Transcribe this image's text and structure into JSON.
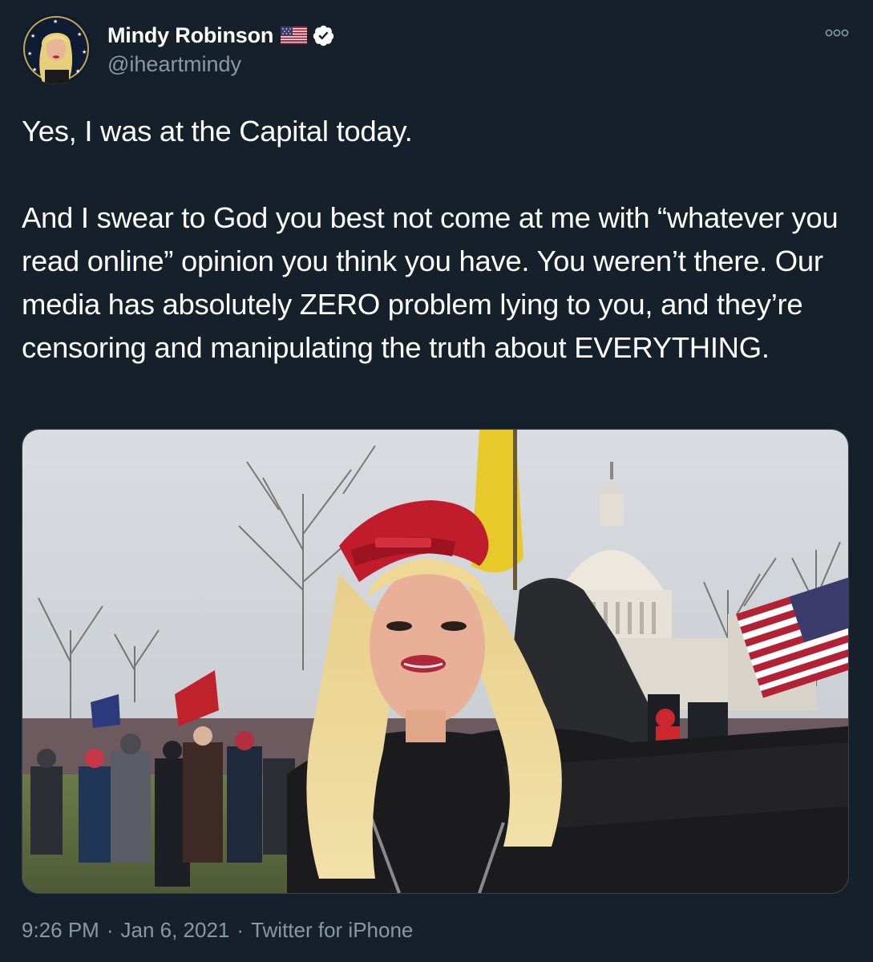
{
  "author": {
    "name": "Mindy Robinson",
    "handle": "@iheartmindy",
    "flag_icon": "us-flag-emoji",
    "verified_icon": "verified-badge-icon",
    "verified_color": "#ffffff"
  },
  "more_icon": "more-options-icon",
  "tweet": {
    "text": "Yes, I was at the Capital today.\n\nAnd I swear to God you best not come at me with “whatever you read online” opinion you think you have. You weren’t there. Our media has absolutely ZERO problem lying to you, and they’re censoring and manipulating the truth about EVERYTHING."
  },
  "meta": {
    "time": "9:26 PM",
    "date": "Jan 6, 2021",
    "source": "Twitter for iPhone",
    "separator": "·"
  },
  "colors": {
    "background": "#15202b",
    "text": "#ffffff",
    "secondary": "#8899a6",
    "border": "#38444d"
  }
}
